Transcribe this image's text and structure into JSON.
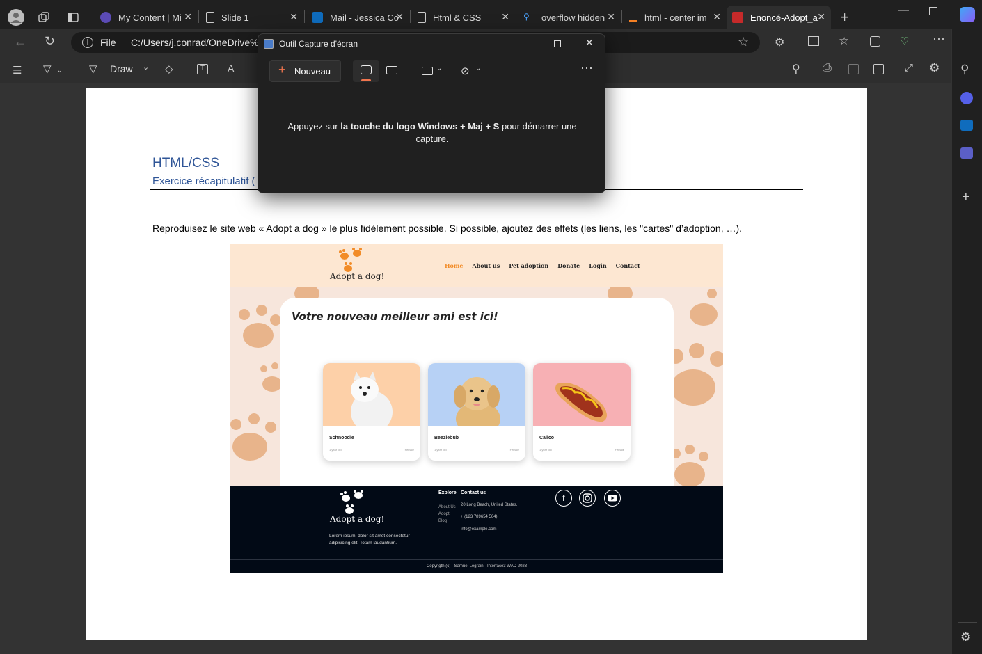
{
  "browser": {
    "tabs": [
      {
        "title": "My Content | Mi",
        "icon": "content-icon"
      },
      {
        "title": "Slide 1",
        "icon": "doc-icon"
      },
      {
        "title": "Mail - Jessica Co",
        "icon": "outlook-icon"
      },
      {
        "title": "Html & CSS",
        "icon": "doc-icon"
      },
      {
        "title": "overflow hidden",
        "icon": "search-icon"
      },
      {
        "title": "html - center im",
        "icon": "stackoverflow-icon"
      },
      {
        "title": "Enoncé-Adopt_a",
        "icon": "pdf-icon"
      }
    ],
    "address_scheme": "File",
    "address_url": "C:/Users/j.conrad/OneDrive%"
  },
  "pdf_toolbar": {
    "draw_label": "Draw"
  },
  "snip": {
    "title": "Outil Capture d'écran",
    "new_label": "Nouveau",
    "hint_prefix": "Appuyez sur ",
    "hint_bold": "la touche du logo Windows + Maj + S",
    "hint_suffix": " pour démarrer une capture."
  },
  "document": {
    "title": "HTML/CSS",
    "subtitle": "Exercice récapitulatif (",
    "instruction": "Reproduisez le site web « Adopt a dog » le plus fidèlement possible. Si possible, ajoutez des effets (les liens, les \"cartes\" d’adoption, …)."
  },
  "site": {
    "logo_text": "Adopt a dog!",
    "nav": [
      "Home",
      "About us",
      "Pet adoption",
      "Donate",
      "Login",
      "Contact"
    ],
    "hero_title": "Votre nouveau meilleur ami est ici!",
    "cards": [
      {
        "name": "Schnoodle",
        "age": "1 year old",
        "sex": "Female",
        "bg": "#fdd0a8"
      },
      {
        "name": "Beezlebub",
        "age": "1 year old",
        "sex": "Female",
        "bg": "#b7d1f5"
      },
      {
        "name": "Calico",
        "age": "1 year old",
        "sex": "Female",
        "bg": "#f7b0b4"
      }
    ],
    "footer": {
      "logo_text": "Adopt a dog!",
      "description": "Lorem ipsum, dolor sit amet consectetur adipisicing elit. Totam laudantium.",
      "explore_title": "Explore",
      "explore_links": [
        "About Us",
        "Adopt",
        "Blog"
      ],
      "contact_title": "Contact us",
      "address": "20 Long Beach, United States.",
      "phone": "+ (123 789654 564)",
      "email": "info@example.com",
      "copyright": "Copyrigth (c) - Samuel Legrain - Interface3 WAD 2023"
    }
  },
  "colors": {
    "accent_orange": "#f28c28",
    "footer_bg": "#020a16",
    "header_bg": "#fde7d2"
  }
}
